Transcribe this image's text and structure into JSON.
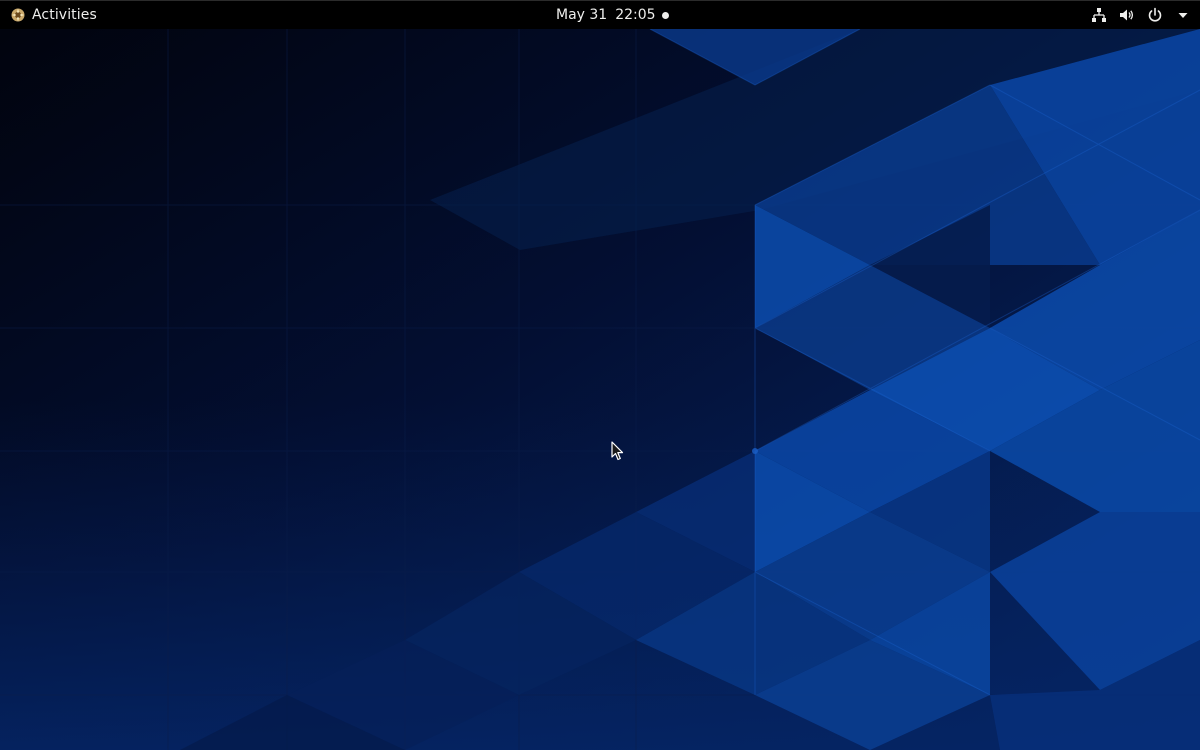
{
  "topbar": {
    "activities_label": "Activities",
    "clock": {
      "date": "May 31",
      "time": "22:05",
      "has_notification_dot": true
    },
    "system_icons": [
      "network-icon",
      "volume-icon",
      "power-icon",
      "chevron-down-icon"
    ]
  },
  "colors": {
    "topbar_bg": "#000000",
    "topbar_text": "#eeeeec",
    "wallpaper_dark": "#020617",
    "wallpaper_blue": "#0a3a8c",
    "wallpaper_bright": "#0b4aa8"
  },
  "desktop": {
    "wallpaper": "low-poly-blue-triangles"
  }
}
